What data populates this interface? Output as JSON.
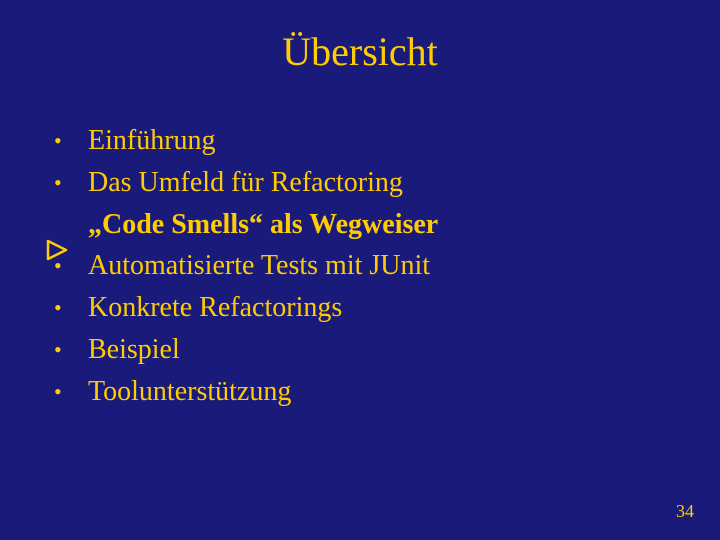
{
  "title": "Übersicht",
  "items": [
    {
      "text": "Einführung",
      "emph": false
    },
    {
      "text": "Das Umfeld für Refactoring",
      "emph": false
    },
    {
      "text": "„Code Smells“ als Wegweiser",
      "emph": true
    },
    {
      "text": "Automatisierte Tests mit JUnit",
      "emph": false
    },
    {
      "text": "Konkrete Refactorings",
      "emph": false
    },
    {
      "text": "Beispiel",
      "emph": false
    },
    {
      "text": "Toolunterstützung",
      "emph": false
    }
  ],
  "page_number": "34"
}
